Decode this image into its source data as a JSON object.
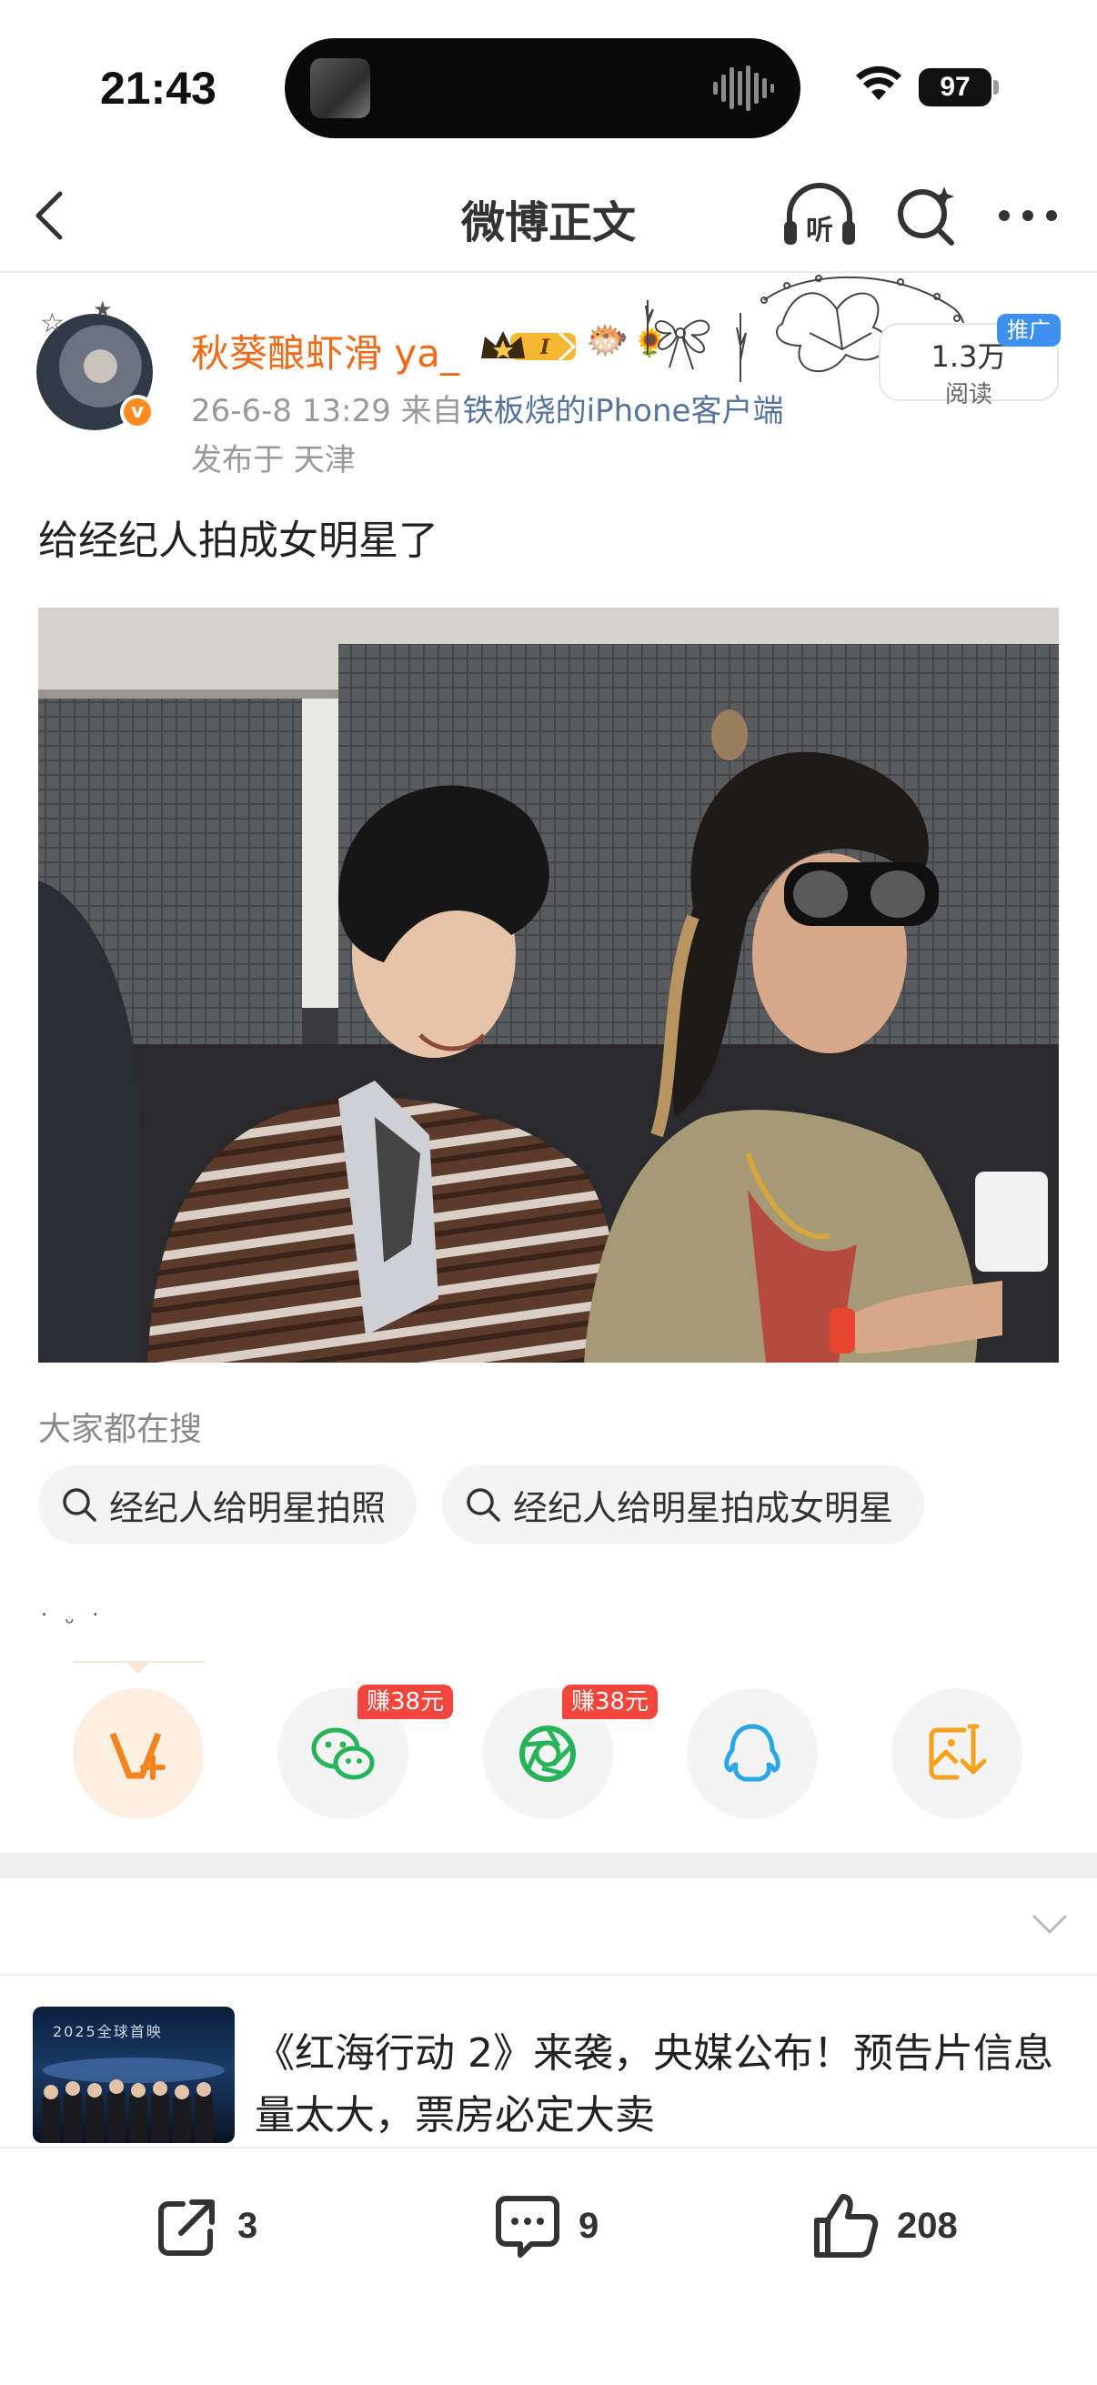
{
  "status_bar": {
    "time": "21:43",
    "battery": "97"
  },
  "nav": {
    "title": "微博正文",
    "listen_label": "听"
  },
  "post": {
    "author": "秋葵酿虾滑 ya_",
    "timestamp": "26-6-8 13:29",
    "source_prefix": "来自",
    "source": "铁板烧的iPhone客户端",
    "location": "发布于 天津",
    "read_count": "1.3万",
    "read_label": "阅读",
    "promo_tag": "推广",
    "text": "给经纪人拍成女明星了"
  },
  "trending": {
    "title": "大家都在搜",
    "chips": [
      "经纪人给明星拍照",
      "经纪人给明星拍成女明星"
    ]
  },
  "kaomoji": "˙ ᵕ ˙",
  "share": {
    "wechat_badge": "赚38元",
    "moments_badge": "赚38元"
  },
  "recommendation": {
    "thumb_text": "2025全球首映",
    "title": "《红海行动 2》来袭，央媒公布！预告片信息量太大，票房必定大卖"
  },
  "actions": {
    "repost": "3",
    "comment": "9",
    "like": "208"
  },
  "colors": {
    "brand_orange": "#f06a18",
    "source_blue": "#56739e",
    "badge_red": "#f2463c"
  }
}
